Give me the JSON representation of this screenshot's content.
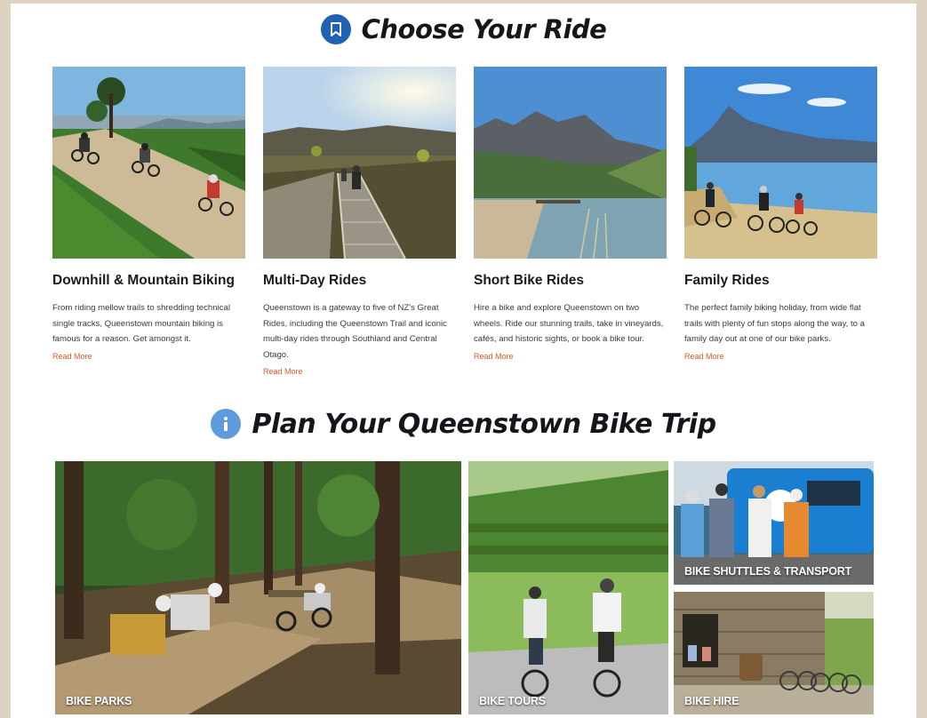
{
  "sections": {
    "choose": {
      "title": "Choose Your Ride",
      "icon": "bookmark-icon"
    },
    "plan": {
      "title": "Plan Your Queenstown Bike Trip",
      "icon": "info-icon"
    }
  },
  "cards": [
    {
      "title": "Downhill & Mountain Biking",
      "description": "From riding mellow trails to shredding technical single tracks, Queenstown mountain biking is famous for a reason. Get amongst it.",
      "link": "Read More"
    },
    {
      "title": "Multi-Day Rides",
      "description": "Queenstown is a gateway to five of NZ's Great Rides, including the Queenstown Trail and iconic multi-day rides through Southland and Central Otago.",
      "link": "Read More"
    },
    {
      "title": "Short Bike Rides",
      "description": "Hire a bike and explore Queenstown on two wheels. Ride our stunning trails, take in vineyards, cafés, and historic sights, or book a bike tour.",
      "link": "Read More"
    },
    {
      "title": "Family Rides",
      "description": "The perfect family biking holiday, from wide flat trails with plenty of fun stops along the way, to a family day out at one of our bike parks.",
      "link": "Read More"
    }
  ],
  "tiles": {
    "parks": "BIKE PARKS",
    "tours": "BIKE TOURS",
    "shuttles": "BIKE SHUTTLES & TRANSPORT",
    "hire": "BIKE HIRE"
  },
  "colors": {
    "background": "#ded3c2",
    "panel": "#ffffff",
    "accent_link": "#e2572b",
    "badge_dark": "#1f62b3",
    "badge_light": "#5f9bdc"
  }
}
